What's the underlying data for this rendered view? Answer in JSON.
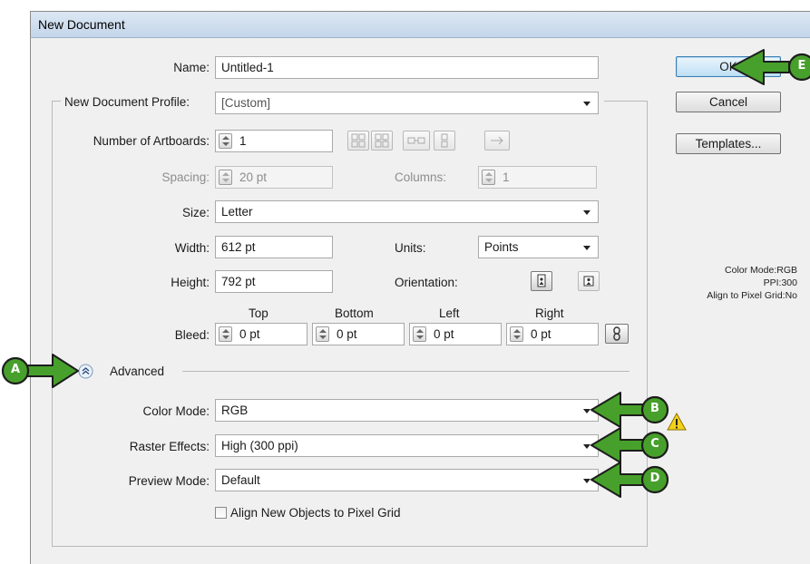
{
  "dialog": {
    "title": "New Document"
  },
  "name": {
    "label": "Name:",
    "value": "Untitled-1"
  },
  "profile": {
    "label": "New Document Profile:",
    "value": "[Custom]"
  },
  "artboards": {
    "label": "Number of Artboards:",
    "value": "1"
  },
  "spacing": {
    "label": "Spacing:",
    "value": "20 pt"
  },
  "columns": {
    "label": "Columns:",
    "value": "1"
  },
  "size": {
    "label": "Size:",
    "value": "Letter"
  },
  "width": {
    "label": "Width:",
    "value": "612 pt"
  },
  "units": {
    "label": "Units:",
    "value": "Points"
  },
  "height": {
    "label": "Height:",
    "value": "792 pt"
  },
  "orientation": {
    "label": "Orientation:"
  },
  "bleed": {
    "label": "Bleed:",
    "top_label": "Top",
    "top_value": "0 pt",
    "bottom_label": "Bottom",
    "bottom_value": "0 pt",
    "left_label": "Left",
    "left_value": "0 pt",
    "right_label": "Right",
    "right_value": "0 pt"
  },
  "advanced": {
    "label": "Advanced"
  },
  "color_mode": {
    "label": "Color Mode:",
    "value": "RGB"
  },
  "raster_effects": {
    "label": "Raster Effects:",
    "value": "High (300 ppi)"
  },
  "preview_mode": {
    "label": "Preview Mode:",
    "value": "Default"
  },
  "pixel_grid": {
    "label": "Align New Objects to Pixel Grid",
    "checked": false
  },
  "buttons": {
    "ok": "OK",
    "cancel": "Cancel",
    "templates": "Templates..."
  },
  "summary": {
    "color_mode": "Color Mode:RGB",
    "ppi": "PPI:300",
    "align": "Align to Pixel Grid:No"
  },
  "callouts": {
    "a": "A",
    "b": "B",
    "c": "C",
    "d": "D",
    "e": "E"
  },
  "colors": {
    "callout_green": "#47a02b",
    "callout_outline": "#1d1d1d",
    "warning_yellow": "#f4d21a"
  },
  "icons": {
    "artboard_layout": [
      "grid-by-row-icon",
      "grid-by-column-icon",
      "arrange-by-row-icon",
      "arrange-by-column-icon",
      "right-to-left-icon"
    ],
    "orientation": [
      "portrait-icon",
      "landscape-icon"
    ],
    "link": "chain-link-icon",
    "advanced_toggle": "collapse-chevron-icon",
    "warning": "warning-icon"
  }
}
